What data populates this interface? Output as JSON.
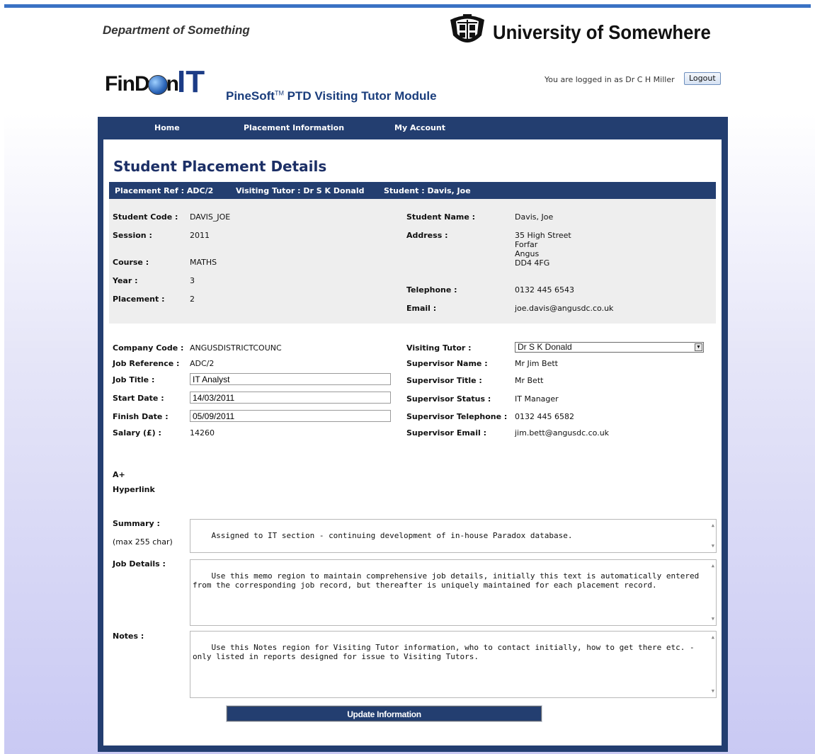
{
  "header": {
    "department": "Department of Something",
    "university": "University of Somewhere",
    "logo_fin": "FinD",
    "logo_n": "n",
    "logo_it": "IT",
    "module_brand": "PineSoft",
    "module_tm": "TM",
    "module_name": " PTD Visiting Tutor Module",
    "logged_in_text": "You are logged in as Dr C H Miller",
    "logout_label": "Logout"
  },
  "nav": {
    "home": "Home",
    "placement": "Placement Information",
    "account": "My Account"
  },
  "page": {
    "title": "Student Placement Details",
    "refbar": {
      "placement_ref": "Placement Ref : ADC/2",
      "visiting_tutor": "Visiting Tutor : Dr S K Donald",
      "student": "Student : Davis, Joe"
    }
  },
  "student": {
    "code_label": "Student Code :",
    "code": "DAVIS_JOE",
    "session_label": "Session :",
    "session": "2011",
    "course_label": "Course :",
    "course": "MATHS",
    "year_label": "Year :",
    "year": "3",
    "placement_label": "Placement :",
    "placement": "2",
    "name_label": "Student Name :",
    "name": "Davis, Joe",
    "address_label": "Address :",
    "address": "35 High Street\nForfar\nAngus\nDD4 4FG",
    "telephone_label": "Telephone :",
    "telephone": "0132 445 6543",
    "email_label": "Email :",
    "email": "joe.davis@angusdc.co.uk"
  },
  "job": {
    "company_code_label": "Company Code :",
    "company_code": "ANGUSDISTRICTCOUNC",
    "job_reference_label": "Job Reference :",
    "job_reference": "ADC/2",
    "job_title_label": "Job Title :",
    "job_title": "IT Analyst",
    "start_date_label": "Start Date :",
    "start_date": "14/03/2011",
    "finish_date_label": "Finish Date :",
    "finish_date": "05/09/2011",
    "salary_label": "Salary (£) :",
    "salary": "14260",
    "visiting_tutor_label": "Visiting Tutor :",
    "visiting_tutor": "Dr S K Donald",
    "supervisor_name_label": "Supervisor Name :",
    "supervisor_name": "Mr Jim Bett",
    "supervisor_title_label": "Supervisor Title :",
    "supervisor_title": "Mr Bett",
    "supervisor_status_label": "Supervisor Status :",
    "supervisor_status": "IT Manager",
    "supervisor_telephone_label": "Supervisor Telephone :",
    "supervisor_telephone": "0132 445 6582",
    "supervisor_email_label": "Supervisor Email :",
    "supervisor_email": "jim.bett@angusdc.co.uk"
  },
  "extras": {
    "a_plus": "A+",
    "hyperlink": "Hyperlink"
  },
  "memos": {
    "summary_label": "Summary :",
    "summary_hint": "(max 255 char)",
    "summary": "Assigned to IT section - continuing development of in-house Paradox database.",
    "job_details_label": "Job Details :",
    "job_details": "Use this memo region to maintain comprehensive job details, initially this text is automatically entered from the corresponding job record, but thereafter is uniquely maintained for each placement record.",
    "notes_label": "Notes :",
    "notes": "Use this Notes region for Visiting Tutor information, who to contact initially, how to get there etc. - only listed in reports designed for issue to Visiting Tutors."
  },
  "update_label": "Update Information"
}
